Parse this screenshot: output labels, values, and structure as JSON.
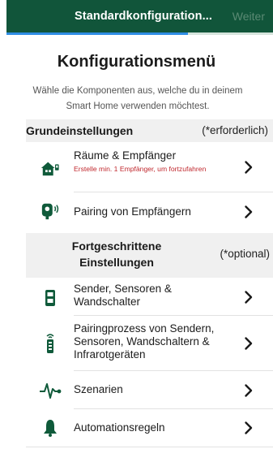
{
  "header": {
    "title": "Standardkonfiguration...",
    "next_label": "Weiter",
    "progress": 0.68
  },
  "menu": {
    "title": "Konfigurationsmenü",
    "intro": "Wähle die Komponenten aus, welche du in deinem Smart Home verwenden möchtest."
  },
  "basic": {
    "title": "Grundeinstellungen",
    "note": "(*erforderlich)",
    "items": [
      {
        "label": "Räume & Empfänger",
        "sublabel": "Erstelle min. 1 Empfänger, um fortzufahren",
        "icon": "house-sensor-icon"
      },
      {
        "label": "Pairing von Empfängern",
        "icon": "pairing-plug-icon"
      }
    ]
  },
  "advanced": {
    "title": "Fortgeschrittene Einstellungen",
    "note": "(*optional)",
    "items": [
      {
        "label": "Sender, Sensoren & Wandschalter",
        "icon": "wall-switch-icon"
      },
      {
        "label": "Pairingprozess von Sendern, Sensoren, Wandschaltern & Infrarotgeräten",
        "icon": "remote-signal-icon"
      },
      {
        "label": "Szenarien",
        "icon": "pulse-icon"
      },
      {
        "label": "Automationsregeln",
        "icon": "bell-icon"
      }
    ]
  },
  "colors": {
    "header_bg": "#11553a",
    "accent_green": "#0f5a3a",
    "progress_blue": "#2f8de4",
    "warning_red": "#c0282e"
  }
}
